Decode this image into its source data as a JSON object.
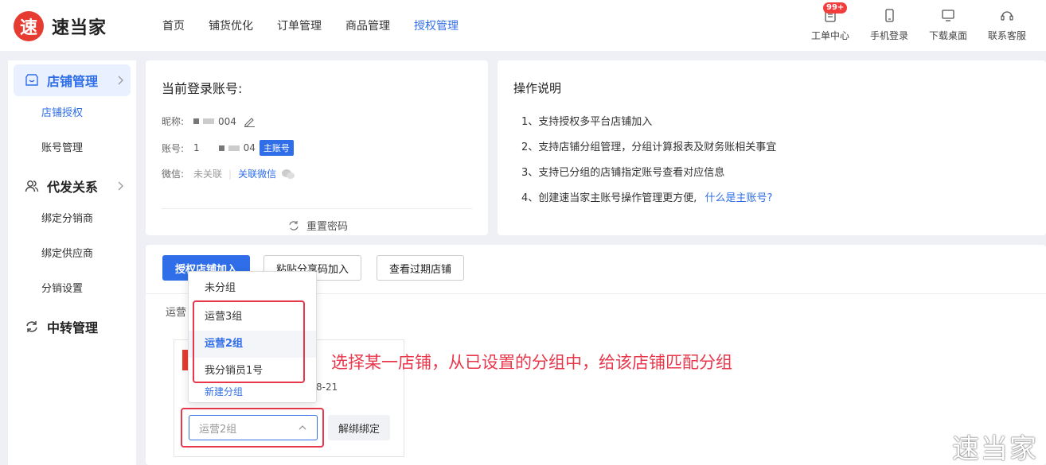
{
  "brand": {
    "logo_char": "速",
    "name": "速当家"
  },
  "nav": {
    "items": [
      "首页",
      "铺货优化",
      "订单管理",
      "商品管理",
      "授权管理"
    ],
    "active_index": 4
  },
  "tools": [
    {
      "label": "工单中心",
      "icon": "ticket-icon",
      "badge": "99+"
    },
    {
      "label": "手机登录",
      "icon": "phone-icon"
    },
    {
      "label": "下载桌面",
      "icon": "desktop-icon"
    },
    {
      "label": "联系客服",
      "icon": "support-icon"
    }
  ],
  "sidebar": {
    "groups": [
      {
        "label": "店铺管理",
        "icon": "store-icon",
        "active": true,
        "items": [
          "店铺授权",
          "账号管理"
        ],
        "active_item": 0
      },
      {
        "label": "代发关系",
        "icon": "users-icon",
        "items": [
          "绑定分销商",
          "绑定供应商",
          "分销设置"
        ]
      },
      {
        "label": "中转管理",
        "icon": "refresh-icon",
        "items": []
      }
    ]
  },
  "account": {
    "title": "当前登录账号:",
    "nickname_label": "昵称:",
    "nickname_suffix": "004",
    "account_label": "账号:",
    "account_prefix": "1",
    "account_suffix": "04",
    "main_tag": "主账号",
    "wechat_label": "微信:",
    "wechat_status": "未关联",
    "wechat_link": "关联微信",
    "reset_label": "重置密码"
  },
  "help": {
    "title": "操作说明",
    "items": [
      "1、支持授权多平台店铺加入",
      "2、支持店铺分组管理，分组计算报表及财务账相关事宜",
      "3、支持已分组的店铺指定账号查看对应信息",
      "4、创建速当家主账号操作管理更方便,"
    ],
    "item4_link": "什么是主账号?"
  },
  "main": {
    "btn_auth": "授权店铺加入",
    "btn_paste": "粘贴分享码加入",
    "btn_expired": "查看过期店铺",
    "group_label": "运营",
    "store_date": "8-21",
    "select_value": "运营2组",
    "unbind": "解绑绑定"
  },
  "dropdown": {
    "options": [
      "未分组",
      "运营3组",
      "运营2组",
      "我分销员1号"
    ],
    "selected_index": 2,
    "new_group": "新建分组"
  },
  "annotation": "选择某一店铺，从已设置的分组中，给该店铺匹配分组",
  "watermark": "速当家",
  "colors": {
    "accent": "#2f6ee8",
    "brand_red": "#e63b30",
    "highlight": "#e8374b"
  }
}
